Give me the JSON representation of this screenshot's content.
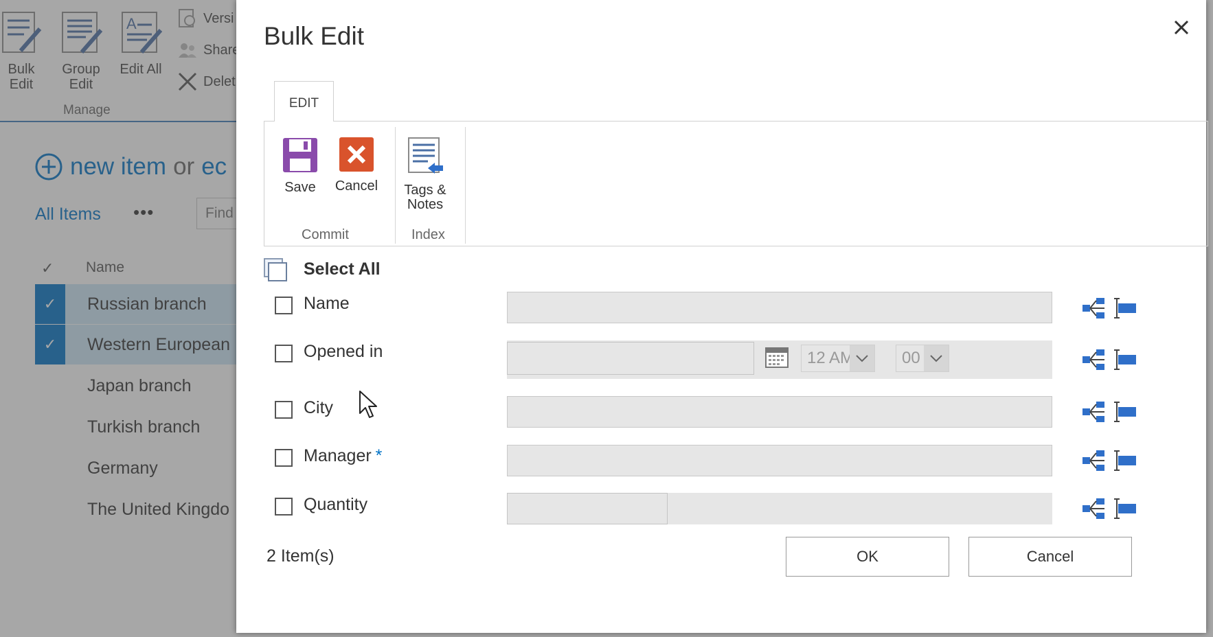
{
  "background": {
    "ribbon": {
      "bulk_edit": "Bulk Edit",
      "group_edit": "Group Edit",
      "edit_all": "Edit All",
      "version": "Versi",
      "share": "Share",
      "delete": "Delet",
      "group_label": "Manage"
    },
    "new_item": {
      "primary": "new item",
      "or": "or",
      "secondary": "ec"
    },
    "view": {
      "name": "All Items",
      "more": "•••",
      "search_placeholder": "Find"
    },
    "list": {
      "check_header": "✓",
      "name_header": "Name",
      "rows": [
        {
          "name": "Russian branch",
          "selected": true
        },
        {
          "name": "Western European",
          "selected": true
        },
        {
          "name": "Japan branch",
          "selected": false
        },
        {
          "name": "Turkish branch",
          "selected": false
        },
        {
          "name": "Germany",
          "selected": false
        },
        {
          "name": "The United Kingdo",
          "selected": false
        }
      ]
    }
  },
  "dialog": {
    "title": "Bulk Edit",
    "close_symbol": "✕",
    "tab": "EDIT",
    "ribbon": {
      "save": "Save",
      "cancel": "Cancel",
      "tags_notes": "Tags & Notes",
      "commit_group": "Commit",
      "index_group": "Index"
    },
    "select_all": "Select All",
    "fields": [
      {
        "label": "Name",
        "required": false
      },
      {
        "label": "Opened in",
        "required": false
      },
      {
        "label": "City",
        "required": false
      },
      {
        "label": "Manager",
        "required": true,
        "required_mark": "*"
      },
      {
        "label": "Quantity",
        "required": false
      }
    ],
    "date_time": {
      "hour": "12 AM",
      "minute": "00"
    },
    "item_count": "2  Item(s)",
    "ok": "OK",
    "cancel": "Cancel"
  },
  "colors": {
    "accent": "#0072c6",
    "selected_row": "#cde6f7",
    "save_icon": "#8a4bab",
    "cancel_icon": "#d9532c",
    "field_bg": "#e6e6e6"
  }
}
